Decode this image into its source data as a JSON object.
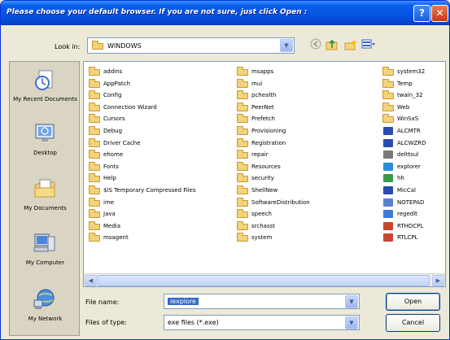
{
  "dialog": {
    "title": "Please choose your default browser. If you are not sure, just click Open :",
    "help_glyph": "?",
    "close_glyph": "✕"
  },
  "lookin": {
    "label": "Look in:",
    "value": "WINDOWS"
  },
  "places": [
    {
      "label": "My Recent Documents",
      "icon": "recent-documents-icon"
    },
    {
      "label": "Desktop",
      "icon": "desktop-icon"
    },
    {
      "label": "My Documents",
      "icon": "my-documents-icon"
    },
    {
      "label": "My Computer",
      "icon": "my-computer-icon"
    },
    {
      "label": "My Network",
      "icon": "my-network-icon"
    }
  ],
  "files": {
    "col1": [
      "addins",
      "AppPatch",
      "Config",
      "Connection Wizard",
      "Cursors",
      "Debug",
      "Driver Cache",
      "ehome",
      "Fonts",
      "Help",
      "$IS Temporary Compressed Files",
      "ime",
      "Java",
      "Media",
      "msagent"
    ],
    "col2": [
      "msapps",
      "mui",
      "pchealth",
      "PeerNet",
      "Prefetch",
      "Provisioning",
      "Registration",
      "repair",
      "Resources",
      "security",
      "ShellNew",
      "SoftwareDistribution",
      "speech",
      "srchasst",
      "system"
    ],
    "col3": [
      {
        "name": "system32",
        "kind": "folder"
      },
      {
        "name": "Temp",
        "kind": "folder"
      },
      {
        "name": "twain_32",
        "kind": "folder"
      },
      {
        "name": "Web",
        "kind": "folder"
      },
      {
        "name": "WinSxS",
        "kind": "folder"
      },
      {
        "name": "ALCMTR",
        "kind": "exe",
        "color": "#2a4cb0"
      },
      {
        "name": "ALCWZRD",
        "kind": "exe",
        "color": "#2a4cb0"
      },
      {
        "name": "delttsul",
        "kind": "exe",
        "color": "#7a7a7a"
      },
      {
        "name": "explorer",
        "kind": "exe",
        "color": "#2a8fd8"
      },
      {
        "name": "hh",
        "kind": "exe",
        "color": "#3c9a4a"
      },
      {
        "name": "MicCal",
        "kind": "exe",
        "color": "#2a4cb0"
      },
      {
        "name": "NOTEPAD",
        "kind": "exe",
        "color": "#5b7fd0"
      },
      {
        "name": "regedit",
        "kind": "exe",
        "color": "#3c7ad6"
      },
      {
        "name": "RTHDCPL",
        "kind": "exe",
        "color": "#c9462c"
      },
      {
        "name": "RTLCPL",
        "kind": "exe",
        "color": "#c9462c"
      }
    ]
  },
  "filename": {
    "label": "File name:",
    "value": "iexplore"
  },
  "filetype": {
    "label": "Files of type:",
    "value": "exe files (*.exe)"
  },
  "buttons": {
    "open": "Open",
    "cancel": "Cancel"
  },
  "colors": {
    "titlebar": "#0554e3",
    "selection": "#316ac5",
    "folder": "#f3d27a"
  }
}
